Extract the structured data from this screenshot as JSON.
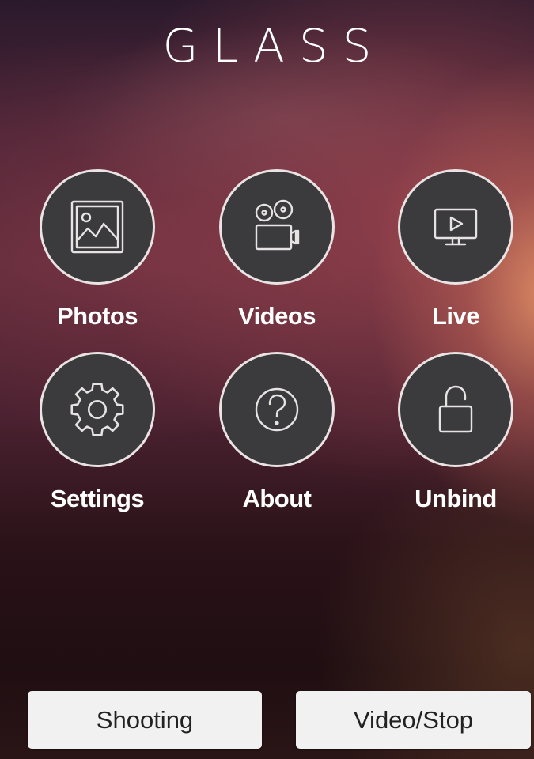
{
  "app": {
    "title": "GLASS"
  },
  "grid": {
    "items": [
      {
        "label": "Photos",
        "icon": "photo-icon"
      },
      {
        "label": "Videos",
        "icon": "video-camera-icon"
      },
      {
        "label": "Live",
        "icon": "live-monitor-icon"
      },
      {
        "label": "Settings",
        "icon": "gear-icon"
      },
      {
        "label": "About",
        "icon": "question-icon"
      },
      {
        "label": "Unbind",
        "icon": "unlock-icon"
      }
    ]
  },
  "buttons": {
    "shooting": "Shooting",
    "video_stop": "Video/Stop"
  },
  "colors": {
    "circle_fill": "#3b3a3c",
    "circle_border": "#e9e3e3",
    "button_bg": "#f1f1f1",
    "text": "#ffffff"
  }
}
